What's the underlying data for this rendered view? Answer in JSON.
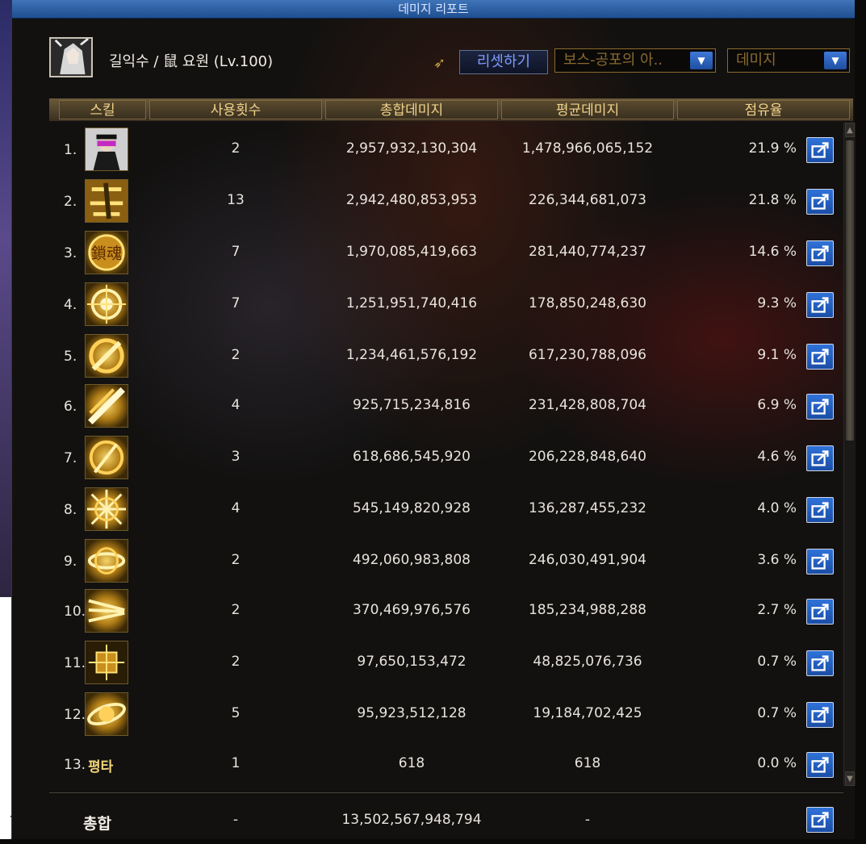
{
  "window": {
    "title": "데미지 리포트"
  },
  "header": {
    "character": "길익수 / 鼠 요원 (Lv.100)",
    "reset_label": "리셋하기",
    "target_select": "보스-공포의 아..",
    "type_select": "데미지"
  },
  "columns": [
    "스킬",
    "사용횟수",
    "총합데미지",
    "평균데미지",
    "점유율"
  ],
  "rows": [
    {
      "rank": "1.",
      "icon": "masked-figure-icon",
      "skill_text": "",
      "uses": "2",
      "total": "2,957,932,130,304",
      "avg": "1,478,966,065,152",
      "share": "21.9 %"
    },
    {
      "rank": "2.",
      "icon": "kick-icon",
      "skill_text": "",
      "uses": "13",
      "total": "2,942,480,853,953",
      "avg": "226,344,681,073",
      "share": "21.8 %"
    },
    {
      "rank": "3.",
      "icon": "kanji-emblem-icon",
      "skill_text": "",
      "uses": "7",
      "total": "1,970,085,419,663",
      "avg": "281,440,774,237",
      "share": "14.6 %"
    },
    {
      "rank": "4.",
      "icon": "target-burst-icon",
      "skill_text": "",
      "uses": "7",
      "total": "1,251,951,740,416",
      "avg": "178,850,248,630",
      "share": "9.3 %"
    },
    {
      "rank": "5.",
      "icon": "slash-circle-icon",
      "skill_text": "",
      "uses": "2",
      "total": "1,234,461,576,192",
      "avg": "617,230,788,096",
      "share": "9.1 %"
    },
    {
      "rank": "6.",
      "icon": "diagonal-blade-icon",
      "skill_text": "",
      "uses": "4",
      "total": "925,715,234,816",
      "avg": "231,428,808,704",
      "share": "6.9 %"
    },
    {
      "rank": "7.",
      "icon": "spin-slash-icon",
      "skill_text": "",
      "uses": "3",
      "total": "618,686,545,920",
      "avg": "206,228,848,640",
      "share": "4.6 %"
    },
    {
      "rank": "8.",
      "icon": "star-burst-icon",
      "skill_text": "",
      "uses": "4",
      "total": "545,149,820,928",
      "avg": "136,287,455,232",
      "share": "4.0 %"
    },
    {
      "rank": "9.",
      "icon": "whirlwind-icon",
      "skill_text": "",
      "uses": "2",
      "total": "492,060,983,808",
      "avg": "246,030,491,904",
      "share": "3.6 %"
    },
    {
      "rank": "10.",
      "icon": "dash-streak-icon",
      "skill_text": "",
      "uses": "2",
      "total": "370,469,976,576",
      "avg": "185,234,988,288",
      "share": "2.7 %"
    },
    {
      "rank": "11.",
      "icon": "crosshair-icon",
      "skill_text": "",
      "uses": "2",
      "total": "97,650,153,472",
      "avg": "48,825,076,736",
      "share": "0.7 %"
    },
    {
      "rank": "12.",
      "icon": "orbit-slash-icon",
      "skill_text": "",
      "uses": "5",
      "total": "95,923,512,128",
      "avg": "19,184,702,425",
      "share": "0.7 %"
    },
    {
      "rank": "13.",
      "icon": "",
      "skill_text": "평타",
      "uses": "1",
      "total": "618",
      "avg": "618",
      "share": "0.0 %"
    }
  ],
  "footer": {
    "label": "총합",
    "uses": "-",
    "total": "13,502,567,948,794",
    "avg": "-"
  },
  "colors": {
    "header_text": "#f1d38b",
    "accent_blue": "#2f72d8",
    "icon_gold": "#f5d36a"
  }
}
